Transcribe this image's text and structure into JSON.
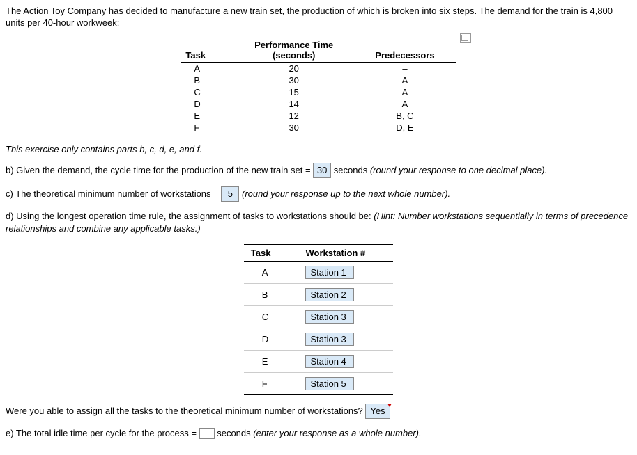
{
  "intro": "The Action Toy Company has decided to manufacture a new train set, the production of which is broken into six steps. The demand for the train is 4,800 units per 40-hour workweek:",
  "task_table": {
    "headers": [
      "Task",
      "Performance Time (seconds)",
      "Predecessors"
    ],
    "h0": "Task",
    "h1_line1": "Performance Time",
    "h1_line2": "(seconds)",
    "h2": "Predecessors",
    "rows": [
      {
        "task": "A",
        "time": "20",
        "pred": "–"
      },
      {
        "task": "B",
        "time": "30",
        "pred": "A"
      },
      {
        "task": "C",
        "time": "15",
        "pred": "A"
      },
      {
        "task": "D",
        "time": "14",
        "pred": "A"
      },
      {
        "task": "E",
        "time": "12",
        "pred": "B, C"
      },
      {
        "task": "F",
        "time": "30",
        "pred": "D, E"
      }
    ]
  },
  "parts_note": "This exercise only contains parts b, c, d, e, and f.",
  "part_b": {
    "text1": "b) Given the demand, the cycle time for the production of the new train set = ",
    "answer": "30",
    "text2": " seconds ",
    "instr": "(round your response to one decimal place)."
  },
  "part_c": {
    "text1": "c) The theoretical minimum number of workstations = ",
    "answer": "5",
    "text2": " ",
    "instr": "(round your response up to the next whole number)."
  },
  "part_d": {
    "text1": "d) Using the longest operation time rule, the assignment of tasks to workstations should be: ",
    "instr": "(Hint: Number workstations sequentially in terms of precedence relationships and combine any applicable tasks.)"
  },
  "ws_table": {
    "h0": "Task",
    "h1": "Workstation #",
    "rows": [
      {
        "task": "A",
        "ws": "Station 1"
      },
      {
        "task": "B",
        "ws": "Station 2"
      },
      {
        "task": "C",
        "ws": "Station 3"
      },
      {
        "task": "D",
        "ws": "Station 3"
      },
      {
        "task": "E",
        "ws": "Station 4"
      },
      {
        "task": "F",
        "ws": "Station 5"
      }
    ]
  },
  "assign_q": {
    "text": "Were you able to assign all the tasks to the theoretical minimum number of workstations? ",
    "answer": "Yes"
  },
  "part_e": {
    "text1": "e) The total idle time per cycle for the process = ",
    "text2": " seconds ",
    "instr": "(enter your response as a whole number)."
  }
}
